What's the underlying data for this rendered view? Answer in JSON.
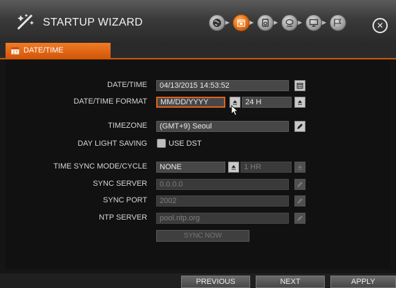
{
  "header": {
    "title": "STARTUP WIZARD",
    "steps": [
      {
        "icon": "language-icon",
        "active": false
      },
      {
        "icon": "calendar-icon",
        "active": true
      },
      {
        "icon": "disk-icon",
        "active": false
      },
      {
        "icon": "network-icon",
        "active": false
      },
      {
        "icon": "display-icon",
        "active": false
      },
      {
        "icon": "finish-flag-icon",
        "active": false
      }
    ],
    "close_icon": "close-icon"
  },
  "tab": {
    "label": "DATE/TIME",
    "icon": "calendar-icon"
  },
  "form": {
    "datetime": {
      "label": "DATE/TIME",
      "value": "04/13/2015 14:53:52"
    },
    "format": {
      "label": "DATE/TIME FORMAT",
      "date_value": "MM/DD/YYYY",
      "time_value": "24 H"
    },
    "timezone": {
      "label": "TIMEZONE",
      "value": "(GMT+9) Seoul"
    },
    "dst": {
      "label": "DAY LIGHT SAVING",
      "checkbox_label": "USE DST",
      "checked": false
    },
    "sync_mode": {
      "label": "TIME SYNC MODE/CYCLE",
      "value": "NONE",
      "cycle": "1 HR"
    },
    "sync_server": {
      "label": "SYNC SERVER",
      "value": "0.0.0.0"
    },
    "sync_port": {
      "label": "SYNC PORT",
      "value": "2002"
    },
    "ntp_server": {
      "label": "NTP SERVER",
      "value": "pool.ntp.org"
    },
    "sync_now": "SYNC NOW"
  },
  "footer": {
    "previous": "PREVIOUS",
    "next": "NEXT",
    "apply": "APPLY"
  },
  "colors": {
    "accent": "#e0631c",
    "panel": "#111111",
    "field": "#474747"
  }
}
